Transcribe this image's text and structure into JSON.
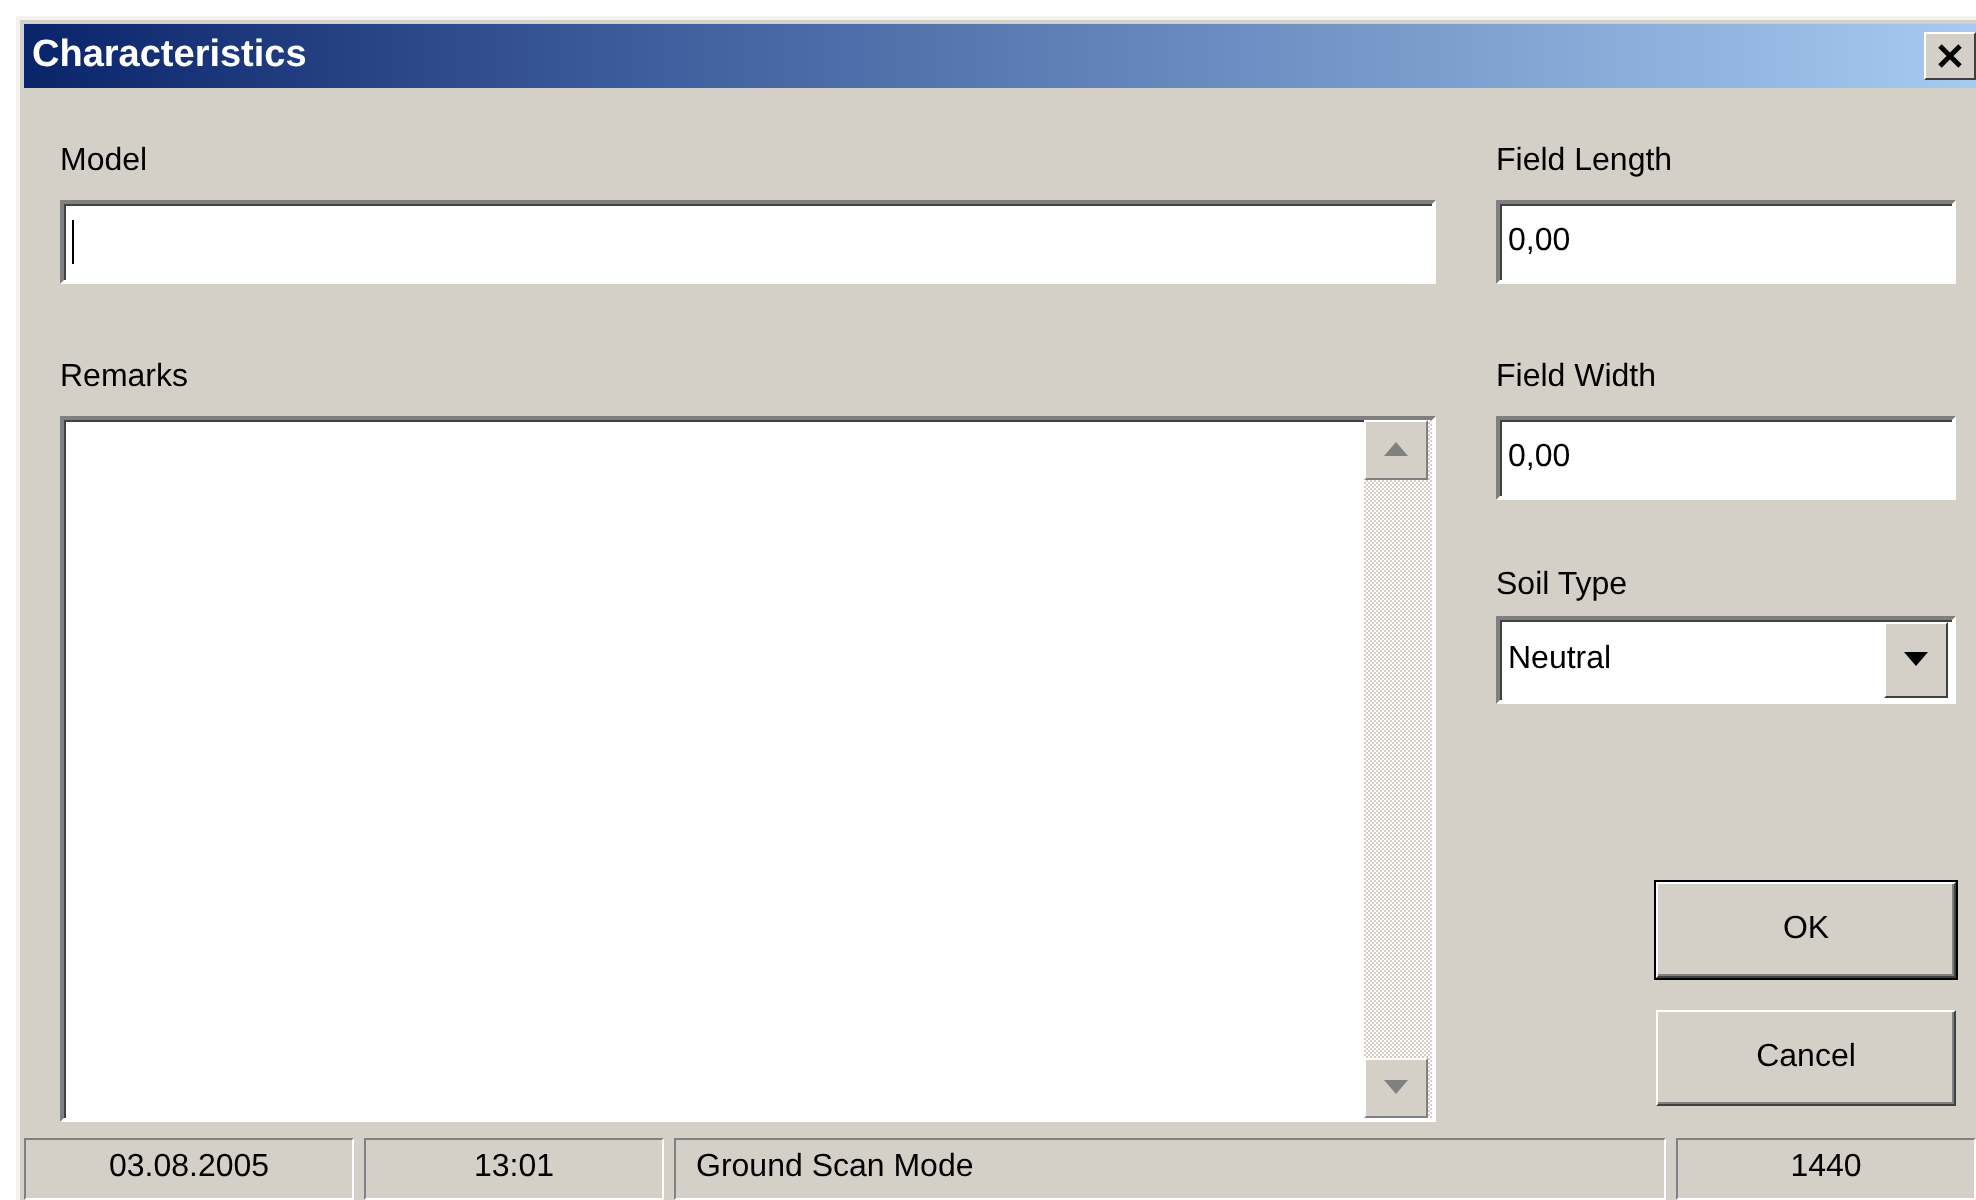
{
  "window": {
    "title": "Characteristics"
  },
  "model": {
    "label": "Model",
    "focused": true
  },
  "remarks": {
    "label": "Remarks"
  },
  "field_length": {
    "label": "Field Length",
    "value": "0,00"
  },
  "field_width": {
    "label": "Field Width",
    "value": "0,00"
  },
  "soil_type": {
    "label": "Soil Type",
    "value": "Neutral"
  },
  "buttons": [
    {
      "label": "OK",
      "default": true
    },
    {
      "label": "Cancel",
      "default": false
    }
  ],
  "status_bar": [
    "03.08.2005",
    "13:01",
    "Ground Scan Mode",
    "1440"
  ]
}
